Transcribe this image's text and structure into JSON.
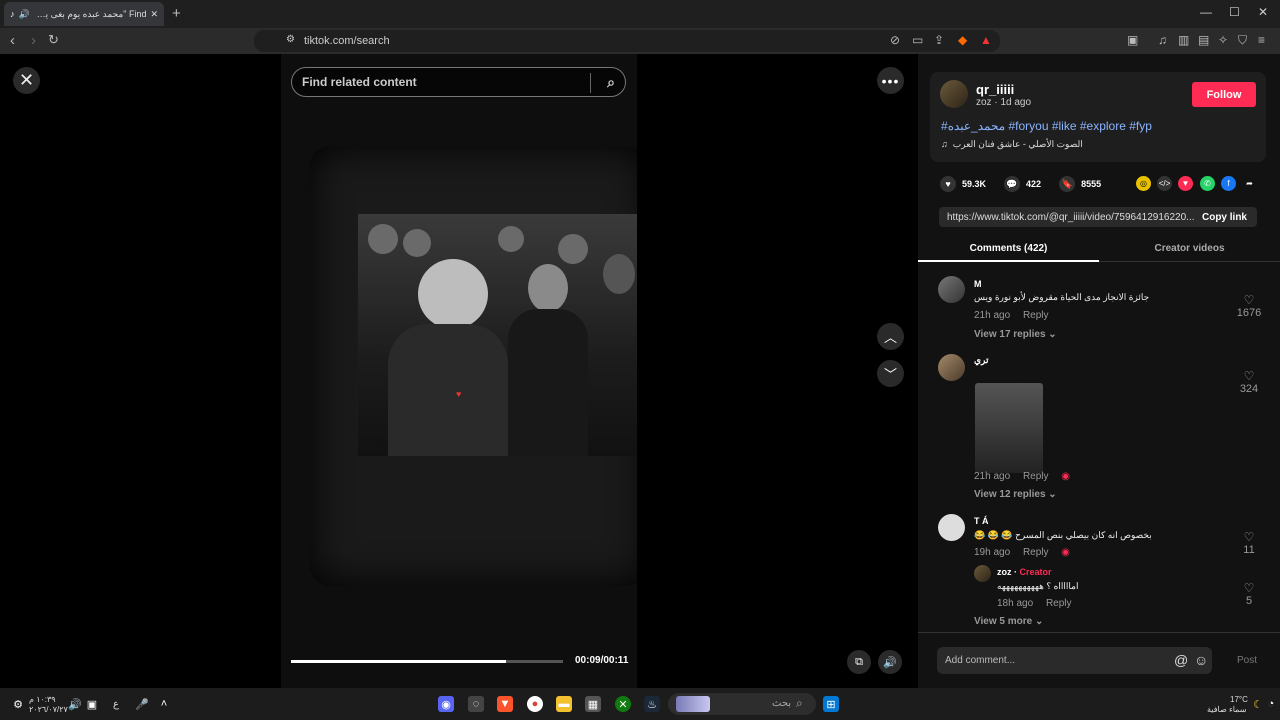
{
  "browser": {
    "tab_title": "Find \"محمد عبده يوم بغى يصلي",
    "url": "tiktok.com/search",
    "window_controls": {
      "minimize": "—",
      "maximize": "☐",
      "close": "✕"
    }
  },
  "video": {
    "search_placeholder": "Find related content",
    "time": "00:09/00:11",
    "progress": 0.79
  },
  "post": {
    "username": "qr_iiiii",
    "subline": "zoz · 1d ago",
    "follow_label": "Follow",
    "hashtags": "#محمد_عبده #foryou #like #explore #fyp",
    "sound": "الصوت الأصلي - عاشق فنان العرب",
    "likes": "59.3K",
    "comments": "422",
    "saves": "8555",
    "link": "https://www.tiktok.com/@qr_iiiii/video/7596412916220...",
    "copy_label": "Copy link"
  },
  "tabs": {
    "comments": "Comments (422)",
    "creator_videos": "Creator videos"
  },
  "comments": [
    {
      "name": "M",
      "text": "جائزة الانجاز مدى الحياة مقروض لأبو نورة ويس",
      "time": "21h ago",
      "reply": "Reply",
      "likes": "1676",
      "view_replies": "View 17 replies"
    },
    {
      "name": "تري",
      "text": "",
      "time": "21h ago",
      "reply": "Reply",
      "likes": "324",
      "view_replies": "View 12 replies"
    },
    {
      "name": "T Á",
      "text": "بخصوص انه كان بيصلي بنص المسرح 😂 😂 😂",
      "time": "19h ago",
      "reply": "Reply",
      "likes": "11",
      "view_replies": "View 5 more"
    }
  ],
  "reply": {
    "name": "zoz",
    "creator": "Creator",
    "text": "اماااااه ؟ ههههههههههه",
    "time": "18h ago",
    "reply": "Reply",
    "likes": "5"
  },
  "add_comment": {
    "placeholder": "Add comment...",
    "post": "Post"
  },
  "taskbar": {
    "search": "بحث",
    "time": "١٠:٣٩ م",
    "date": "٢٠٢٦/٠٧/٢٧",
    "weather_temp": "17°C",
    "weather_desc": "سماء صافية",
    "lang": "ع"
  }
}
